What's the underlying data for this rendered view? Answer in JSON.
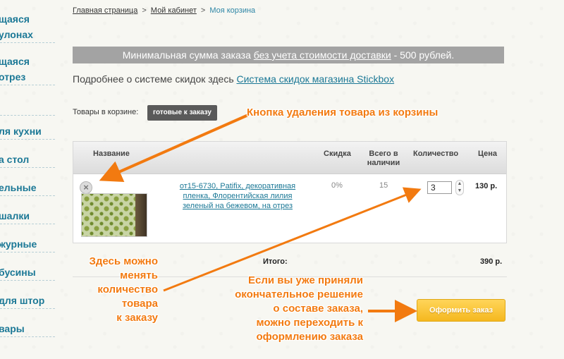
{
  "sidebar": {
    "items": [
      {
        "label": "щаяся"
      },
      {
        "label": "улонах"
      },
      {
        "label": "щаяся"
      },
      {
        "label": "отрез"
      },
      {
        "label": "ля кухни"
      },
      {
        "label": "а стол"
      },
      {
        "label": "ельные"
      },
      {
        "label": "шалки"
      },
      {
        "label": "журные"
      },
      {
        "label": "бусины"
      },
      {
        "label": "для штор"
      },
      {
        "label": "вары"
      }
    ]
  },
  "breadcrumb": {
    "home": "Главная страница",
    "cabinet": "Мой кабинет",
    "current": "Моя корзина",
    "separator": ">"
  },
  "notice": {
    "prefix": "Минимальная сумма заказа ",
    "link": "без учета стоимости доставки",
    "suffix": " - 500 рублей."
  },
  "discount": {
    "text": "Подробнее о системе скидок здесь ",
    "link": "Система скидок магазина Stickbox"
  },
  "cart": {
    "label": "Товары в корзине:",
    "badge": "готовые к заказу"
  },
  "table": {
    "headers": {
      "name": "Название",
      "discount": "Скидка",
      "stock_line1": "Всего в",
      "stock_line2": "наличии",
      "quantity": "Количество",
      "price": "Цена"
    },
    "rows": [
      {
        "product": "от15-6730, Patifix, декоративная пленка, Флорентийская лилия зеленый на бежевом, на отрез",
        "discount": "0%",
        "stock": "15",
        "quantity": "3",
        "price": "130 р."
      }
    ],
    "remove_icon": "×"
  },
  "totals": {
    "label": "Итого:",
    "value": "390 р."
  },
  "checkout": {
    "label": "Оформить заказ"
  },
  "annotations": {
    "remove": "Кнопка удаления товара из корзины",
    "qty": [
      "Здесь можно",
      "менять",
      "количество",
      "товара",
      "к заказу"
    ],
    "checkout": [
      "Если вы уже приняли",
      "окончательное решение",
      "о составе заказа,",
      "можно переходить к",
      "оформлению заказа"
    ]
  },
  "colors": {
    "accent": "#1b7896",
    "annotation": "#f27a10",
    "checkout": "#f5b81f"
  }
}
